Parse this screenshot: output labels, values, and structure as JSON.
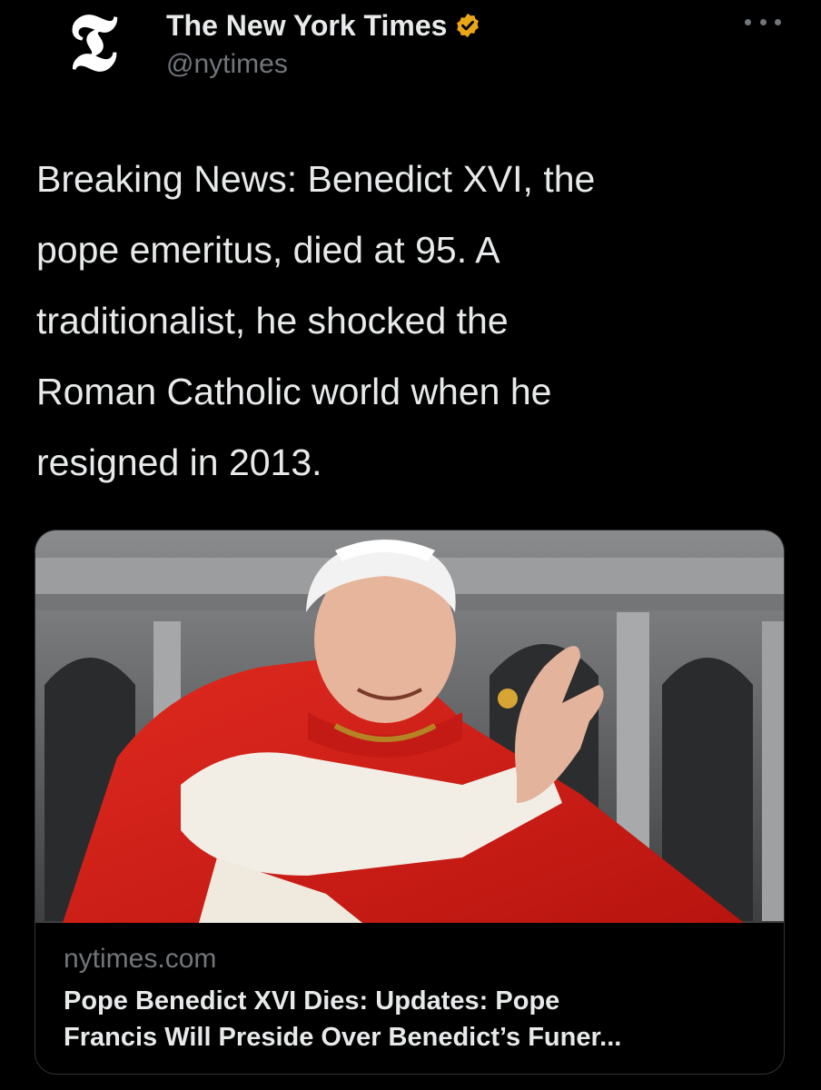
{
  "tweet": {
    "author": {
      "avatar_glyph": "𝕿",
      "display_name": "The New York Times",
      "handle": "@nytimes",
      "verified_icon": "verified-badge-icon",
      "verified_color": "#e9a619"
    },
    "more_icon": "more-options-icon",
    "text_lines": [
      "Breaking News: Benedict XVI, the",
      "pope emeritus, died at 95. A",
      "traditionalist, he shocked the",
      "Roman Catholic world when he",
      "resigned in 2013."
    ],
    "card": {
      "domain": "nytimes.com",
      "title_lines": [
        "Pope Benedict XVI Dies: Updates: Pope",
        "Francis Will Preside Over Benedict’s Funer..."
      ],
      "image": "photo of Pope Benedict XVI waving, wearing red cape"
    }
  },
  "colors": {
    "background": "#000000",
    "primary_text": "#e7e9ea",
    "secondary_text": "#71767b",
    "card_border": "#2f3336"
  }
}
